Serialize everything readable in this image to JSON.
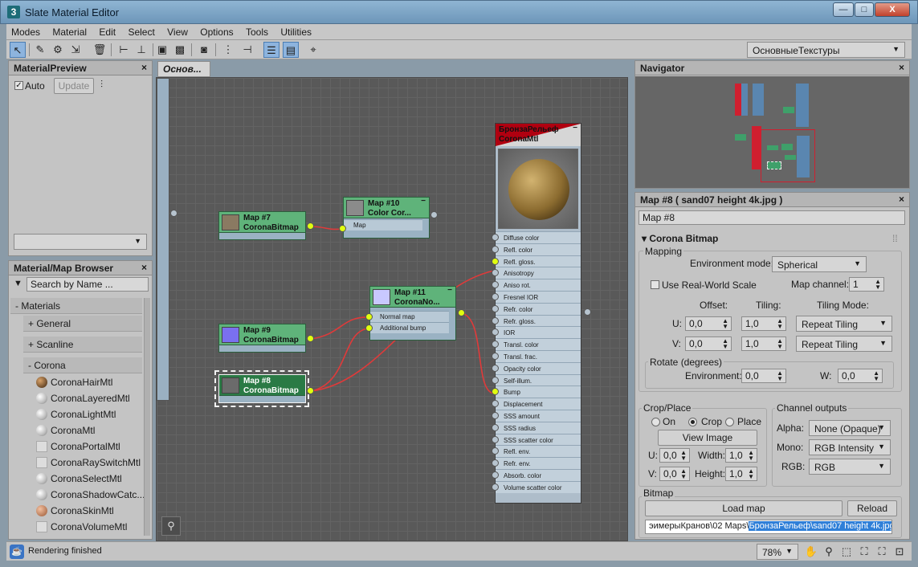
{
  "window": {
    "title": "Slate Material Editor",
    "app_icon": "3",
    "min": "—",
    "max": "□",
    "close": "X"
  },
  "menu": [
    "Modes",
    "Material",
    "Edit",
    "Select",
    "View",
    "Options",
    "Tools",
    "Utilities"
  ],
  "toolbar": {
    "layout_dropdown": "ОсновныеТекстуры"
  },
  "preview": {
    "title": "MaterialPreview",
    "auto_label": "Auto",
    "auto_checked": "✓",
    "update_label": "Update"
  },
  "browser": {
    "title": "Material/Map Browser",
    "search_placeholder": "Search by Name ...",
    "section": "- Materials",
    "groups": [
      "+ General",
      "+ Scanline",
      "- Corona"
    ],
    "items": [
      "CoronaHairMtl",
      "CoronaLayeredMtl",
      "CoronaLightMtl",
      "CoronaMtl",
      "CoronaPortalMtl",
      "CoronaRaySwitchMtl",
      "CoronaSelectMtl",
      "CoronaShadowCatc...",
      "CoronaSkinMtl",
      "CoronaVolumeMtl"
    ]
  },
  "view": {
    "tab": "Основ...",
    "zoom": "78%"
  },
  "nodes": {
    "map7": {
      "title1": "Map #7",
      "title2": "CoronaBitmap"
    },
    "map10": {
      "title1": "Map #10",
      "title2": "Color Cor...",
      "slot": "Map"
    },
    "map11": {
      "title1": "Map #11",
      "title2": "CoronaNo...",
      "slots": [
        "Normal map",
        "Additional bump"
      ]
    },
    "map9": {
      "title1": "Map #9",
      "title2": "CoronaBitmap"
    },
    "map8": {
      "title1": "Map #8",
      "title2": "CoronaBitmap"
    },
    "mat": {
      "title1": "БронзаРельеф",
      "title2": "CoronaMtl",
      "slots": [
        "Diffuse color",
        "Refl. color",
        "Refl. gloss.",
        "Anisotropy",
        "Aniso rot.",
        "Fresnel IOR",
        "Refr. color",
        "Refr. gloss.",
        "IOR",
        "Transl. color",
        "Transl. frac.",
        "Opacity color",
        "Self-illum.",
        "Bump",
        "Displacement",
        "SSS amount",
        "SSS radius",
        "SSS scatter color",
        "Refl. env.",
        "Refr. env.",
        "Absorb. color",
        "Volume scatter color"
      ]
    }
  },
  "navigator": {
    "title": "Navigator"
  },
  "props": {
    "title": "Map #8 ( sand07 height 4k.jpg )",
    "name_value": "Map #8",
    "rollout": "Corona Bitmap",
    "mapping": {
      "label": "Mapping",
      "env_mode_label": "Environment mode:",
      "env_mode": "Spherical",
      "real_world": "Use Real-World Scale",
      "map_channel_label": "Map channel:",
      "map_channel": "1",
      "offset_label": "Offset:",
      "tiling_label": "Tiling:",
      "tiling_mode_label": "Tiling Mode:",
      "u_label": "U:",
      "v_label": "V:",
      "u_offset": "0,0",
      "v_offset": "0,0",
      "u_tiling": "1,0",
      "v_tiling": "1,0",
      "u_mode": "Repeat Tiling",
      "v_mode": "Repeat Tiling",
      "rotate_label": "Rotate (degrees)",
      "env_rot_label": "Environment:",
      "env_rot": "0,0",
      "w_label": "W:",
      "w_rot": "0,0"
    },
    "crop": {
      "label": "Crop/Place",
      "on": "On",
      "crop": "Crop",
      "place": "Place",
      "view_image": "View Image",
      "u_label": "U:",
      "v_label": "V:",
      "u": "0,0",
      "v": "0,0",
      "width_label": "Width:",
      "height_label": "Height:",
      "width": "1,0",
      "height": "1,0"
    },
    "channel": {
      "label": "Channel outputs",
      "alpha_label": "Alpha:",
      "alpha": "None (Opaque)",
      "mono_label": "Mono:",
      "mono": "RGB Intensity",
      "rgb_label": "RGB:",
      "rgb": "RGB"
    },
    "bitmap": {
      "label": "Bitmap",
      "load": "Load map",
      "reload": "Reload",
      "path_prefix": "эимерыКранов\\02 Maps\\",
      "path_selected": "БронзаРельеф\\sand07 height 4k.jpg"
    }
  },
  "status": {
    "text": "Rendering finished"
  },
  "colors": {
    "node_green": "#5fb37a",
    "socket_yellow": "#e0ff10",
    "wire_red": "#e03a3a",
    "selection_blue": "#2f7fd8"
  }
}
